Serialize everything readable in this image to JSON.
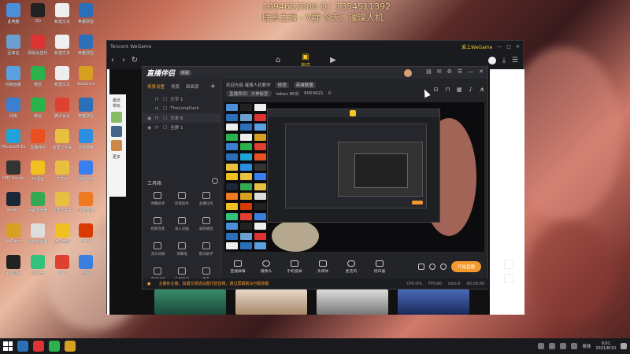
{
  "overlay": {
    "line1": "1094652080  Q：1354511392",
    "line2": "联系主播 - V群  今天：璀璨人机"
  },
  "desktop_icons": [
    {
      "label": "此电脑",
      "color": "#4a8fd8"
    },
    {
      "label": "QQ",
      "color": "#222"
    },
    {
      "label": "新建文本",
      "color": "#eee"
    },
    {
      "label": "英雄联盟",
      "color": "#2a6fb8"
    },
    {
      "label": "回收站",
      "color": "#6a9fd0"
    },
    {
      "label": "网易云音乐",
      "color": "#d33"
    },
    {
      "label": "新建文本",
      "color": "#eee"
    },
    {
      "label": "英雄联盟",
      "color": "#2a6fb8"
    },
    {
      "label": "控制面板",
      "color": "#5a9fe0"
    },
    {
      "label": "微信",
      "color": "#29b34a"
    },
    {
      "label": "新建文本",
      "color": "#eee"
    },
    {
      "label": "WeGame",
      "color": "#d8a020"
    },
    {
      "label": "网络",
      "color": "#3a7fd0"
    },
    {
      "label": "微信",
      "color": "#29b34a"
    },
    {
      "label": "腾讯会议",
      "color": "#e04030"
    },
    {
      "label": "英雄联盟",
      "color": "#2a6fb8"
    },
    {
      "label": "Microsoft Edge",
      "color": "#1fa3d8"
    },
    {
      "label": "直播伴侣",
      "color": "#e85020"
    },
    {
      "label": "新建文件夹",
      "color": "#e8c040"
    },
    {
      "label": "百度网盘",
      "color": "#2a8fe0"
    },
    {
      "label": "OBS Studio",
      "color": "#333"
    },
    {
      "label": "YY语音",
      "color": "#f0c020"
    },
    {
      "label": "文件夹",
      "color": "#e8c040"
    },
    {
      "label": "游戏加加",
      "color": "#3a7ff0"
    },
    {
      "label": "Steam",
      "color": "#1b2838"
    },
    {
      "label": "谷歌浏览器",
      "color": "#34a853"
    },
    {
      "label": "新建文件夹",
      "color": "#e8c040"
    },
    {
      "label": "斗鱼直播",
      "color": "#f07a20"
    },
    {
      "label": "WeGame",
      "color": "#d8a020"
    },
    {
      "label": "雷神加速器",
      "color": "#ddd"
    },
    {
      "label": "虎牙直播",
      "color": "#f0c020"
    },
    {
      "label": "Office",
      "color": "#d83b01"
    },
    {
      "label": "手机助手",
      "color": "#222"
    },
    {
      "label": "QQ音乐",
      "color": "#31c27c"
    },
    {
      "label": "WPS",
      "color": "#e04030"
    },
    {
      "label": "迅雷",
      "color": "#3a7fe0"
    }
  ],
  "wegame": {
    "brand": "Tencent WeGame",
    "store_label": "商店",
    "user_label": "爱上WeGame",
    "side_panel": {
      "title": "最近",
      "subtitle": "常玩",
      "more": "更多"
    }
  },
  "companion": {
    "logo": "直播伴侣",
    "tag": "新版",
    "tabs": [
      "场景设置",
      "场景",
      "画面源"
    ],
    "sources": [
      {
        "name": "文字 1",
        "visible": false
      },
      {
        "name": "TheLongDark",
        "visible": false
      },
      {
        "name": "文本 6",
        "visible": true
      },
      {
        "name": "全屏 1",
        "visible": true
      }
    ],
    "tools_title": "工具箱",
    "tools": [
      "弹幕助手",
      "房管助手",
      "主播任务",
      "视频连麦",
      "录入动画",
      "录屏播放",
      "流水日报",
      "弹幕墙",
      "歌词助手",
      "直播计时",
      "礼物特效",
      "更多"
    ],
    "info": {
      "title": "欢迎光临 璀璨人机教学",
      "edit": "修改",
      "category": "英雄联盟",
      "room": "直播房间：大神秘室",
      "token": "token 80分",
      "fans": "6050621",
      "likes": "0"
    },
    "toolbar": [
      "直播屏幕",
      "摄像头",
      "手机投屏",
      "多媒体",
      "麦克风",
      "扬声器"
    ],
    "start_label": "开始直播",
    "status": {
      "warning": "主播你主播，如遇文频请设置代替音频，通过屏幕跑马可视按键",
      "cpu": "CPU:0%",
      "fps": "FPS:60",
      "bitrate": "kb/s:0",
      "time": "00:00:00"
    }
  },
  "taskbar": {
    "apps": [
      {
        "name": "英雄联盟",
        "color": "#2a6fb8"
      },
      {
        "name": "网易云音乐",
        "color": "#d33"
      },
      {
        "name": "微信",
        "color": "#29b34a"
      },
      {
        "name": "WeGame",
        "color": "#d8a020"
      }
    ],
    "ime": "简体",
    "time": "0:01",
    "date": "2021/8/10"
  }
}
